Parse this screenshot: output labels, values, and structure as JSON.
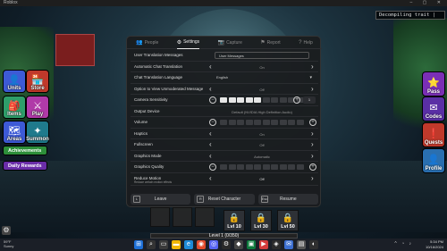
{
  "window": {
    "title": "Roblox",
    "controls": "– ▢ ✕"
  },
  "toast": "Decompiling trait |",
  "left_menu": [
    {
      "label": "Units",
      "color": "#3d5ad6",
      "icon": "👤"
    },
    {
      "label": "Store",
      "color": "#c0392b",
      "icon": "🏪"
    },
    {
      "label": "Items",
      "color": "#2e9e6a",
      "icon": "🎒"
    },
    {
      "label": "Play",
      "color": "#b03aa8",
      "icon": "⚔"
    },
    {
      "label": "Areas",
      "color": "#3d5ad6",
      "icon": "🗺"
    },
    {
      "label": "Summon",
      "color": "#1f7a8c",
      "icon": "✦"
    }
  ],
  "achievements_label": "Achievements",
  "daily_rewards_label": "Daily Rewards",
  "right_menu": [
    {
      "label": "Pass",
      "color": "#7a2fb5",
      "icon": "⭐"
    },
    {
      "label": "Codes",
      "color": "#5a2fa5",
      "icon": "✉"
    },
    {
      "label": "Quests",
      "color": "#c0392b",
      "icon": "❗"
    },
    {
      "label": "Profile",
      "color": "#2a6fb0",
      "icon": "👤"
    }
  ],
  "tabs": [
    {
      "label": "People",
      "icon": "👥",
      "active": false
    },
    {
      "label": "Settings",
      "icon": "⚙",
      "active": true
    },
    {
      "label": "Capture",
      "icon": "📷",
      "active": false
    },
    {
      "label": "Report",
      "icon": "⚑",
      "active": false
    },
    {
      "label": "Help",
      "icon": "?",
      "active": false
    }
  ],
  "settings": {
    "user_translation": {
      "name": "User Translation Messages",
      "value": "User Messages"
    },
    "auto_chat_translation": {
      "name": "Automatic Chat Translation",
      "value": "On"
    },
    "chat_translation_language": {
      "name": "Chat Translation Language",
      "value": "English"
    },
    "unmoderated_message": {
      "name": "Option to View Unmoderated Message",
      "value": "Off"
    },
    "camera_sensitivity": {
      "name": "Camera Sensitivity",
      "value": "1",
      "segments_on": 5,
      "segments_total": 10
    },
    "output_device": {
      "name": "Output Device",
      "value": "Default (NVIDIA High Definition Audio)"
    },
    "volume": {
      "name": "Volume",
      "segments_on": 0,
      "segments_total": 10
    },
    "haptics": {
      "name": "Haptics",
      "value": "On"
    },
    "fullscreen": {
      "name": "Fullscreen",
      "value": "Off"
    },
    "graphics_mode": {
      "name": "Graphics Mode",
      "value": "Automatic"
    },
    "graphics_quality": {
      "name": "Graphics Quality",
      "segments_on": 0,
      "segments_total": 10
    },
    "reduce_motion": {
      "name": "Reduce Motion",
      "sub": "Reduce certain motion effects",
      "value": "Off"
    }
  },
  "bottom_buttons": [
    {
      "key": "L",
      "label": "Leave"
    },
    {
      "key": "R",
      "label": "Reset Character"
    },
    {
      "key": "Esc",
      "label": "Resume"
    }
  ],
  "levels": [
    {
      "label": "Lvl 10"
    },
    {
      "label": "Lvl 30"
    },
    {
      "label": "Lvl 50"
    }
  ],
  "level_progress": "Level 1 (0/350)",
  "taskbar": {
    "weather_temp": "59°F",
    "weather_desc": "Sunny",
    "time": "5:34 PM",
    "date": "10/16/2024"
  }
}
